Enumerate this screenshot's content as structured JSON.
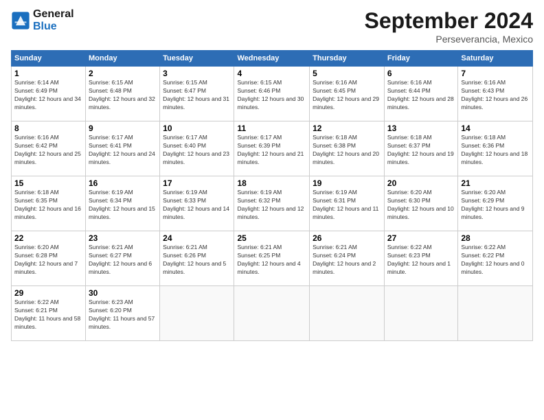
{
  "logo": {
    "text_general": "General",
    "text_blue": "Blue"
  },
  "header": {
    "month": "September 2024",
    "location": "Perseverancia, Mexico"
  },
  "weekdays": [
    "Sunday",
    "Monday",
    "Tuesday",
    "Wednesday",
    "Thursday",
    "Friday",
    "Saturday"
  ],
  "weeks": [
    [
      {
        "day": "1",
        "sunrise": "6:14 AM",
        "sunset": "6:49 PM",
        "daylight": "12 hours and 34 minutes."
      },
      {
        "day": "2",
        "sunrise": "6:15 AM",
        "sunset": "6:48 PM",
        "daylight": "12 hours and 32 minutes."
      },
      {
        "day": "3",
        "sunrise": "6:15 AM",
        "sunset": "6:47 PM",
        "daylight": "12 hours and 31 minutes."
      },
      {
        "day": "4",
        "sunrise": "6:15 AM",
        "sunset": "6:46 PM",
        "daylight": "12 hours and 30 minutes."
      },
      {
        "day": "5",
        "sunrise": "6:16 AM",
        "sunset": "6:45 PM",
        "daylight": "12 hours and 29 minutes."
      },
      {
        "day": "6",
        "sunrise": "6:16 AM",
        "sunset": "6:44 PM",
        "daylight": "12 hours and 28 minutes."
      },
      {
        "day": "7",
        "sunrise": "6:16 AM",
        "sunset": "6:43 PM",
        "daylight": "12 hours and 26 minutes."
      }
    ],
    [
      {
        "day": "8",
        "sunrise": "6:16 AM",
        "sunset": "6:42 PM",
        "daylight": "12 hours and 25 minutes."
      },
      {
        "day": "9",
        "sunrise": "6:17 AM",
        "sunset": "6:41 PM",
        "daylight": "12 hours and 24 minutes."
      },
      {
        "day": "10",
        "sunrise": "6:17 AM",
        "sunset": "6:40 PM",
        "daylight": "12 hours and 23 minutes."
      },
      {
        "day": "11",
        "sunrise": "6:17 AM",
        "sunset": "6:39 PM",
        "daylight": "12 hours and 21 minutes."
      },
      {
        "day": "12",
        "sunrise": "6:18 AM",
        "sunset": "6:38 PM",
        "daylight": "12 hours and 20 minutes."
      },
      {
        "day": "13",
        "sunrise": "6:18 AM",
        "sunset": "6:37 PM",
        "daylight": "12 hours and 19 minutes."
      },
      {
        "day": "14",
        "sunrise": "6:18 AM",
        "sunset": "6:36 PM",
        "daylight": "12 hours and 18 minutes."
      }
    ],
    [
      {
        "day": "15",
        "sunrise": "6:18 AM",
        "sunset": "6:35 PM",
        "daylight": "12 hours and 16 minutes."
      },
      {
        "day": "16",
        "sunrise": "6:19 AM",
        "sunset": "6:34 PM",
        "daylight": "12 hours and 15 minutes."
      },
      {
        "day": "17",
        "sunrise": "6:19 AM",
        "sunset": "6:33 PM",
        "daylight": "12 hours and 14 minutes."
      },
      {
        "day": "18",
        "sunrise": "6:19 AM",
        "sunset": "6:32 PM",
        "daylight": "12 hours and 12 minutes."
      },
      {
        "day": "19",
        "sunrise": "6:19 AM",
        "sunset": "6:31 PM",
        "daylight": "12 hours and 11 minutes."
      },
      {
        "day": "20",
        "sunrise": "6:20 AM",
        "sunset": "6:30 PM",
        "daylight": "12 hours and 10 minutes."
      },
      {
        "day": "21",
        "sunrise": "6:20 AM",
        "sunset": "6:29 PM",
        "daylight": "12 hours and 9 minutes."
      }
    ],
    [
      {
        "day": "22",
        "sunrise": "6:20 AM",
        "sunset": "6:28 PM",
        "daylight": "12 hours and 7 minutes."
      },
      {
        "day": "23",
        "sunrise": "6:21 AM",
        "sunset": "6:27 PM",
        "daylight": "12 hours and 6 minutes."
      },
      {
        "day": "24",
        "sunrise": "6:21 AM",
        "sunset": "6:26 PM",
        "daylight": "12 hours and 5 minutes."
      },
      {
        "day": "25",
        "sunrise": "6:21 AM",
        "sunset": "6:25 PM",
        "daylight": "12 hours and 4 minutes."
      },
      {
        "day": "26",
        "sunrise": "6:21 AM",
        "sunset": "6:24 PM",
        "daylight": "12 hours and 2 minutes."
      },
      {
        "day": "27",
        "sunrise": "6:22 AM",
        "sunset": "6:23 PM",
        "daylight": "12 hours and 1 minute."
      },
      {
        "day": "28",
        "sunrise": "6:22 AM",
        "sunset": "6:22 PM",
        "daylight": "12 hours and 0 minutes."
      }
    ],
    [
      {
        "day": "29",
        "sunrise": "6:22 AM",
        "sunset": "6:21 PM",
        "daylight": "11 hours and 58 minutes."
      },
      {
        "day": "30",
        "sunrise": "6:23 AM",
        "sunset": "6:20 PM",
        "daylight": "11 hours and 57 minutes."
      },
      null,
      null,
      null,
      null,
      null
    ]
  ]
}
